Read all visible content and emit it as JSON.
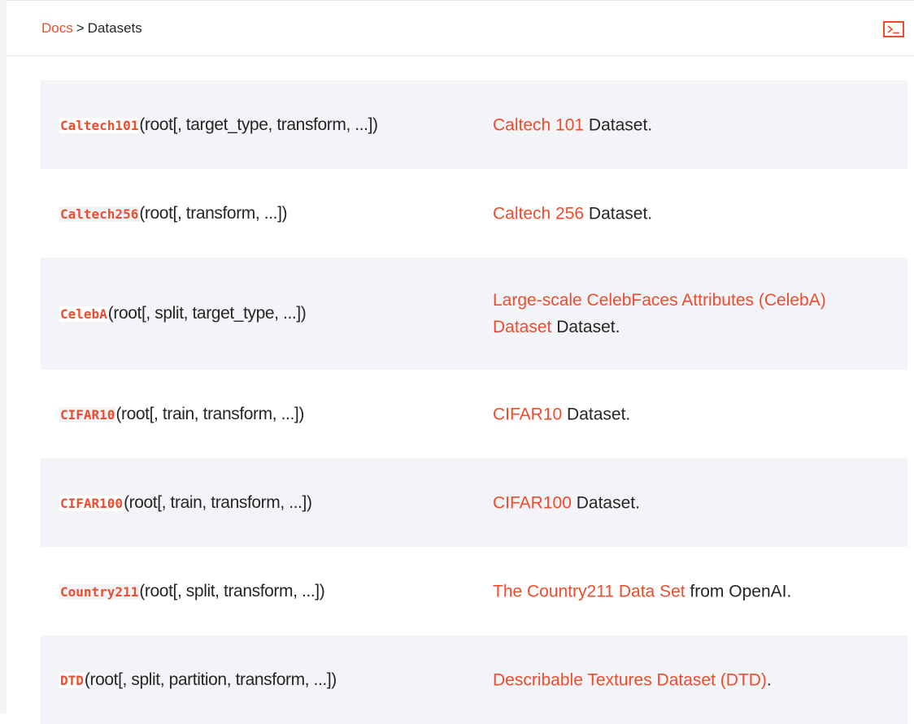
{
  "breadcrumb": {
    "root_label": "Docs",
    "separator": ">",
    "current": "Datasets"
  },
  "header": {
    "terminal_button_icon": "terminal-icon"
  },
  "colors": {
    "accent": "#ee4c2c",
    "row_shade": "#f3f4f7",
    "text": "#262626"
  },
  "rows": [
    {
      "name": "Caltech101",
      "args": "(root[, target_type, transform, ...])",
      "link": "Caltech 101",
      "suffix": " Dataset."
    },
    {
      "name": "Caltech256",
      "args": "(root[, transform, ...])",
      "link": "Caltech 256",
      "suffix": " Dataset."
    },
    {
      "name": "CelebA",
      "args": "(root[, split, target_type, ...])",
      "link": "Large-scale CelebFaces Attributes (CelebA) Dataset",
      "suffix": " Dataset."
    },
    {
      "name": "CIFAR10",
      "args": "(root[, train, transform, ...])",
      "link": "CIFAR10",
      "suffix": " Dataset."
    },
    {
      "name": "CIFAR100",
      "args": "(root[, train, transform, ...])",
      "link": "CIFAR100",
      "suffix": " Dataset."
    },
    {
      "name": "Country211",
      "args": "(root[, split, transform, ...])",
      "link": "The Country211 Data Set",
      "suffix": " from OpenAI."
    },
    {
      "name": "DTD",
      "args": "(root[, split, partition, transform, ...])",
      "link": "Describable Textures Dataset (DTD)",
      "suffix": "."
    }
  ]
}
